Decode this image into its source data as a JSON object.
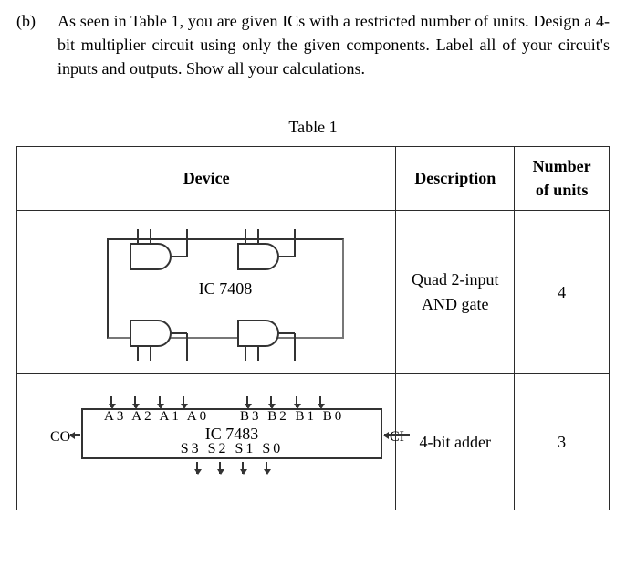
{
  "question": {
    "label": "(b)",
    "text": "As seen in Table 1, you are given ICs with a restricted number of units. Design a 4-bit multiplier circuit using only the given components. Label all of your circuit's inputs and outputs.  Show all your calculations."
  },
  "table": {
    "caption": "Table 1",
    "headers": {
      "device": "Device",
      "description": "Description",
      "units": "Number of units"
    },
    "rows": [
      {
        "device_label": "IC 7408",
        "description": "Quad 2-input AND gate",
        "units": "4"
      },
      {
        "device_label": "IC 7483",
        "a_labels": "A3 A2 A1 A0",
        "b_labels": "B3 B2 B1 B0",
        "s_labels": "S3 S2 S1 S0",
        "co_label": "CO",
        "ci_label": "CI",
        "description": "4-bit adder",
        "units": "3"
      }
    ]
  }
}
